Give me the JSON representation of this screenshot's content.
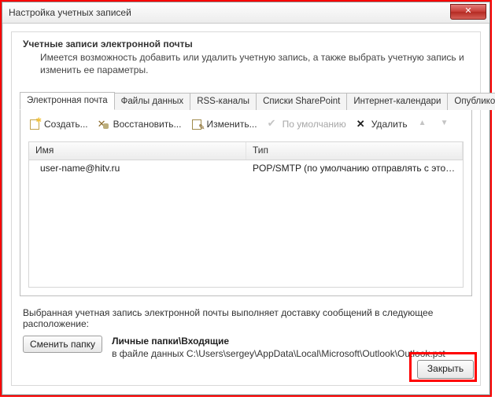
{
  "window": {
    "title": "Настройка учетных записей"
  },
  "header": {
    "title": "Учетные записи электронной почты",
    "description": "Имеется возможность добавить или удалить учетную запись, а также выбрать учетную запись и изменить ее параметры."
  },
  "tabs": [
    {
      "label": "Электронная почта",
      "active": true
    },
    {
      "label": "Файлы данных",
      "active": false
    },
    {
      "label": "RSS-каналы",
      "active": false
    },
    {
      "label": "Списки SharePoint",
      "active": false
    },
    {
      "label": "Интернет-календари",
      "active": false
    },
    {
      "label": "Опубликован",
      "active": false
    }
  ],
  "toolbar": {
    "create": "Создать...",
    "repair": "Восстановить...",
    "change": "Изменить...",
    "default": "По умолчанию",
    "delete": "Удалить"
  },
  "grid": {
    "columns": {
      "name": "Имя",
      "type": "Тип"
    },
    "rows": [
      {
        "name": "user-name@hitv.ru",
        "type": "POP/SMTP (по умолчанию отправлять с этой учет..."
      }
    ]
  },
  "footer": {
    "deliveryText": "Выбранная учетная запись электронной почты выполняет доставку сообщений в следующее расположение:",
    "changeFolder": "Сменить папку",
    "folderTitle": "Личные папки\\Входящие",
    "folderPath": "в файле данных C:\\Users\\sergey\\AppData\\Local\\Microsoft\\Outlook\\Outlook.pst"
  },
  "buttons": {
    "close": "Закрыть"
  }
}
